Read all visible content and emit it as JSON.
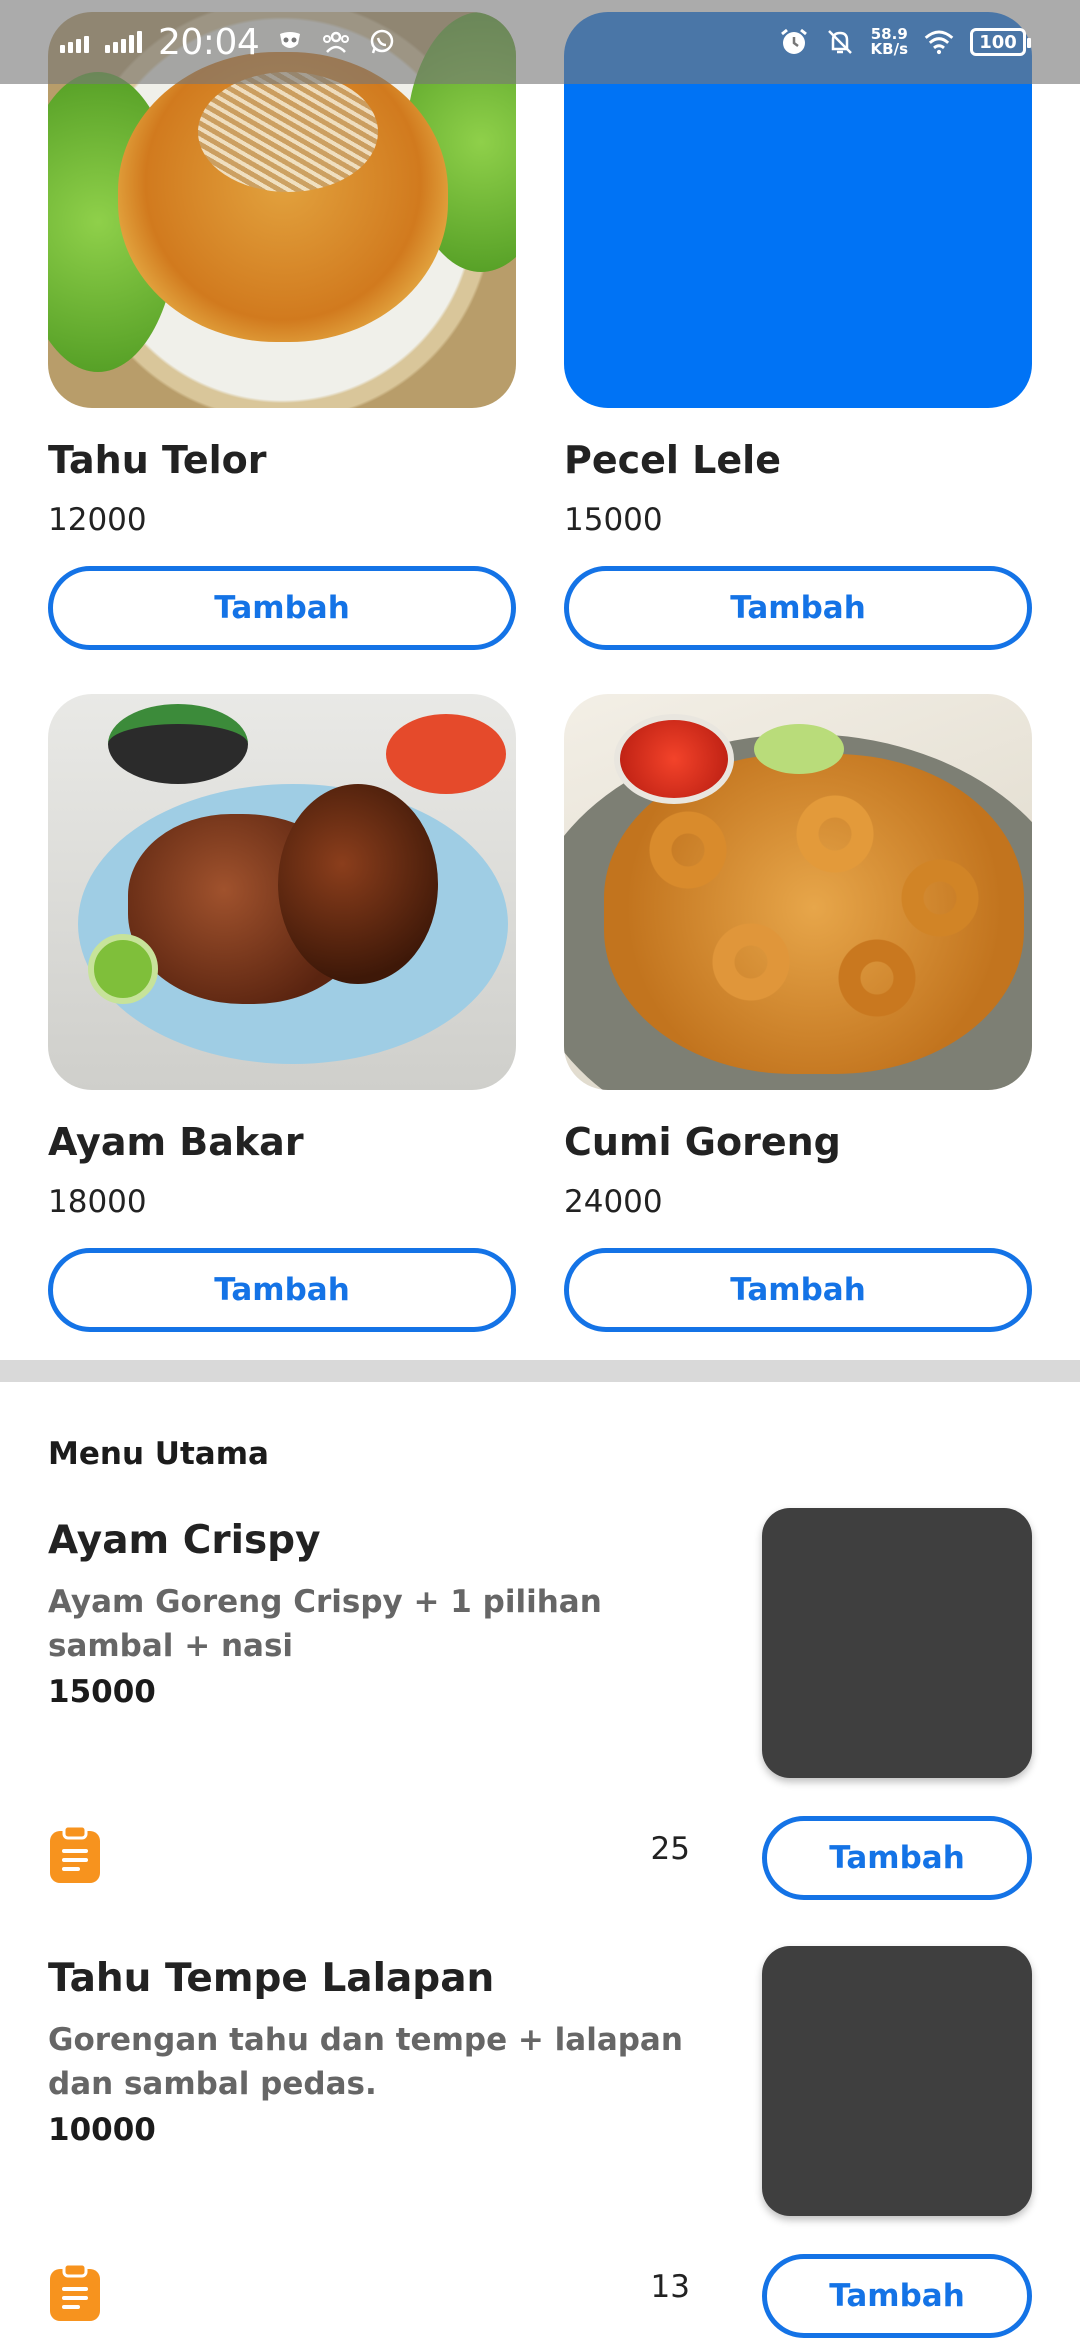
{
  "status_bar": {
    "time": "20:04",
    "net_speed_value": "58.9",
    "net_speed_unit": "KB/s",
    "battery": "100",
    "icons": [
      "signal-icon",
      "signal-icon",
      "mask-icon",
      "group-icon",
      "whatsapp-icon",
      "alarm-icon",
      "bell-off-icon",
      "wifi-icon",
      "battery-icon"
    ]
  },
  "grid": [
    {
      "name": "Tahu Telor",
      "price": "12000",
      "button": "Tambah"
    },
    {
      "name": "Pecel Lele",
      "price": "15000",
      "button": "Tambah"
    },
    {
      "name": "Ayam Bakar",
      "price": "18000",
      "button": "Tambah"
    },
    {
      "name": "Cumi Goreng",
      "price": "24000",
      "button": "Tambah"
    }
  ],
  "section": {
    "title": "Menu Utama"
  },
  "menu_items": [
    {
      "name": "Ayam Crispy",
      "description": "Ayam Goreng Crispy + 1 pilihan sambal + nasi",
      "price": "15000",
      "stock": "25",
      "button": "Tambah"
    },
    {
      "name": "Tahu Tempe Lalapan",
      "description": "Gorengan tahu dan tempe + lalapan dan sambal pedas.",
      "price": "10000",
      "stock": "13",
      "button": "Tambah"
    }
  ],
  "colors": {
    "accent": "#1473e6",
    "icon_orange": "#f7931e",
    "thumb_gray": "#3f3f3f",
    "placeholder_blue": "#0073f5"
  }
}
